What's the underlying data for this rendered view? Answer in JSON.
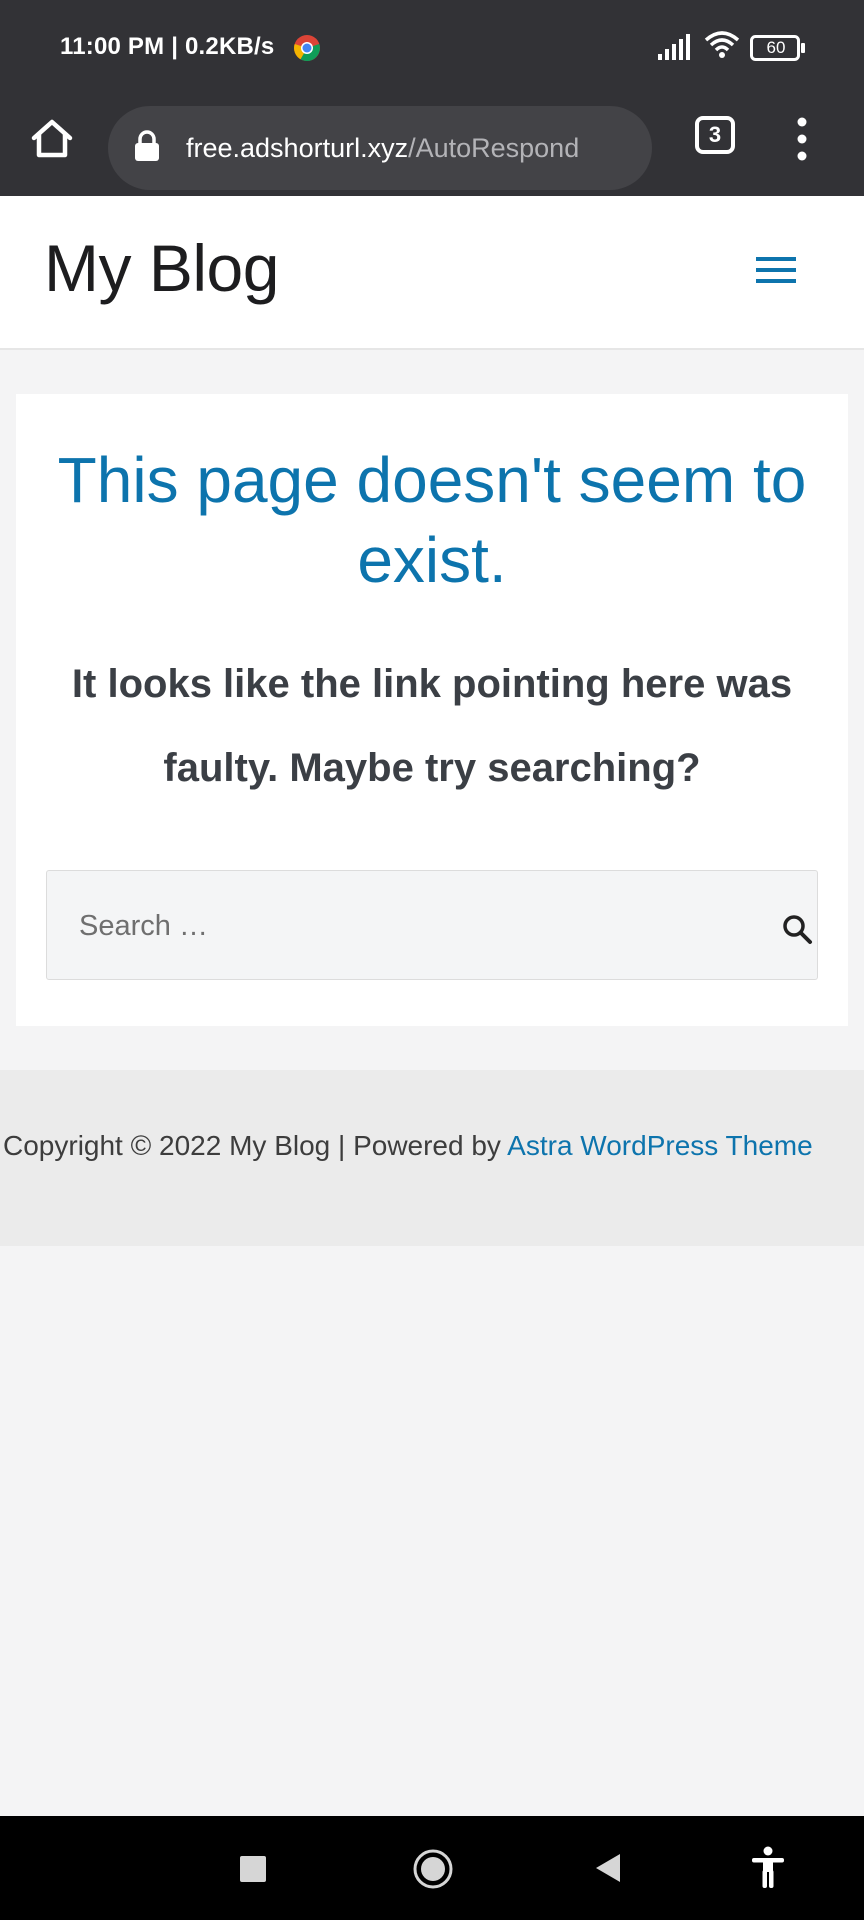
{
  "status_bar": {
    "time": "11:00 PM | 0.2KB/s",
    "battery": "60"
  },
  "browser": {
    "url_domain": "free.adshorturl.xyz",
    "url_path": "/AutoRespond",
    "tab_count": "3"
  },
  "site": {
    "title": "My Blog"
  },
  "content": {
    "error_title": "This page doesn't seem to exist.",
    "error_subtitle": "It looks like the link pointing here was faulty. Maybe try searching?",
    "search_placeholder": "Search …"
  },
  "footer": {
    "text": "Copyright © 2022 My Blog | Powered by ",
    "link_label": "Astra WordPress Theme"
  },
  "colors": {
    "accent": "#0d74ad",
    "status_bar": "#323236",
    "page_bg": "#f4f4f5"
  }
}
